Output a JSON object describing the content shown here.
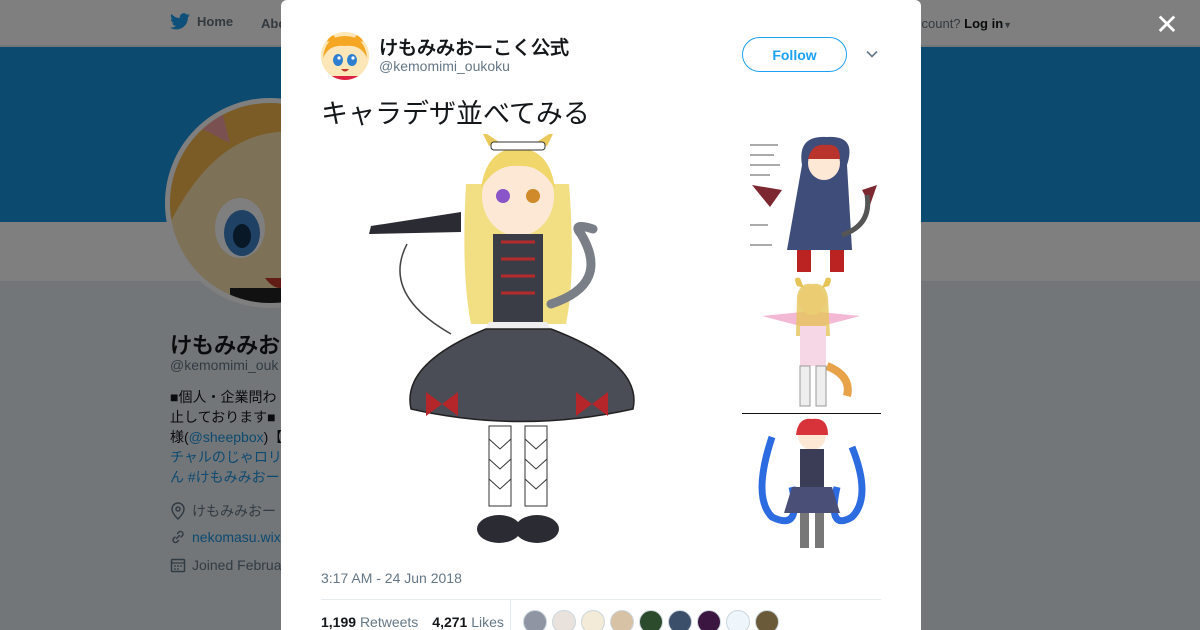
{
  "topbar": {
    "home_label": "Home",
    "about_label": "Abo",
    "login_prefix": "ccount?",
    "login_label": "Log in"
  },
  "profile": {
    "name": "けもみみお",
    "handle": "@kemomimi_ouk",
    "bio_lines": [
      "■個人・企業問わ",
      "止しております■",
      "様(",
      "チャルのじゃロリ",
      "ん #けもみみおー"
    ],
    "bio_mention": "@sheepbox",
    "bio_after_mention": ")【",
    "location": "けもみみおー",
    "website": "nekomasu.wix",
    "joined": "Joined Februa"
  },
  "tweet": {
    "author_name": "けもみみおーこく公式",
    "author_handle": "@kemomimi_oukoku",
    "follow_label": "Follow",
    "text": "キャラデザ並べてみる",
    "timestamp": "3:17 AM - 24 Jun 2018",
    "retweets_count": "1,199",
    "retweets_label": "Retweets",
    "likes_count": "4,271",
    "likes_label": "Likes",
    "liker_count": 9
  },
  "colors": {
    "accent": "#1da1f2",
    "banner": "#1b95e0",
    "text_muted": "#657786"
  },
  "icons": [
    "twitter-bird-icon",
    "close-icon",
    "chevron-down-icon",
    "location-icon",
    "link-icon",
    "calendar-icon"
  ]
}
